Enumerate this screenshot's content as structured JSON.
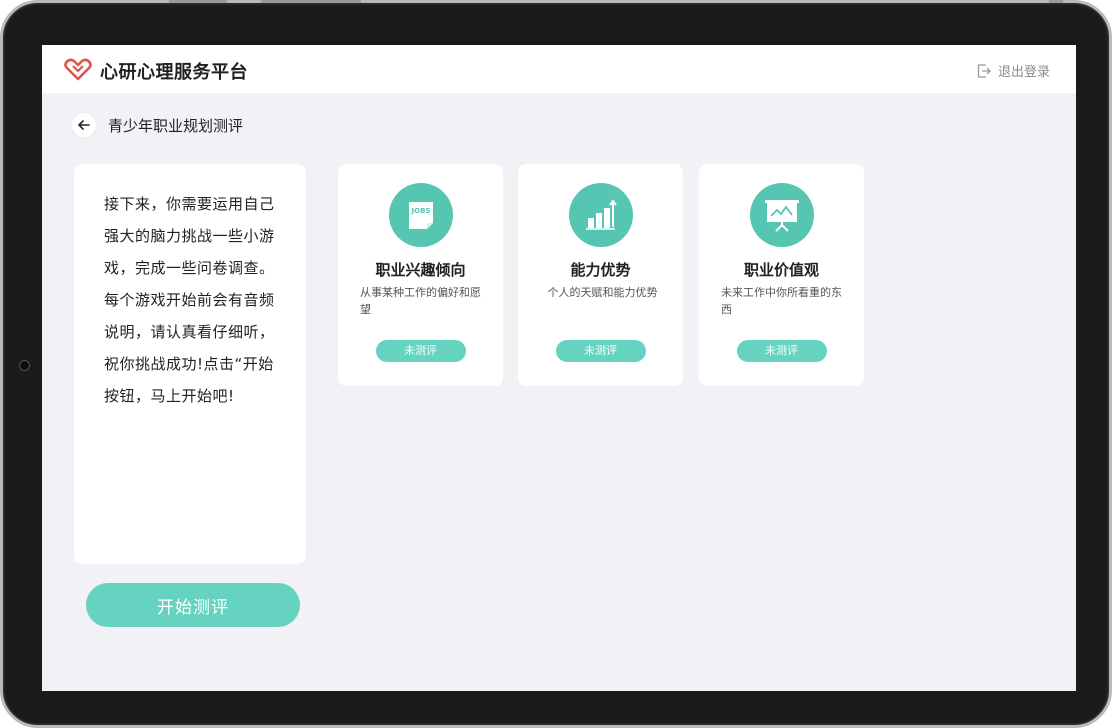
{
  "app": {
    "title": "心研心理服务平台",
    "logout_label": "退出登录"
  },
  "page": {
    "title": "青少年职业规划测评"
  },
  "intro": {
    "text": "接下来，你需要运用自己强大的脑力挑战一些小游戏，完成一些问卷调查。每个游戏开始前会有音频说明，请认真看仔细听，祝你挑战成功!点击“开始按钮，马上开始吧!"
  },
  "start_button": {
    "label": "开始测评"
  },
  "cards": [
    {
      "title": "职业兴趣倾向",
      "desc": "从事某种工作的偏好和愿望",
      "status": "未测评",
      "icon": "jobs-icon"
    },
    {
      "title": "能力优势",
      "desc": "个人的天赋和能力优势",
      "status": "未测评",
      "icon": "bar-chart-icon"
    },
    {
      "title": "职业价值观",
      "desc": "未来工作中你所看重的东西",
      "status": "未测评",
      "icon": "presentation-board-icon"
    }
  ],
  "colors": {
    "accent": "#65d3c0",
    "icon_bg": "#56c6b2",
    "screen_bg": "#f1f1f6",
    "logo_red": "#e0554e"
  }
}
